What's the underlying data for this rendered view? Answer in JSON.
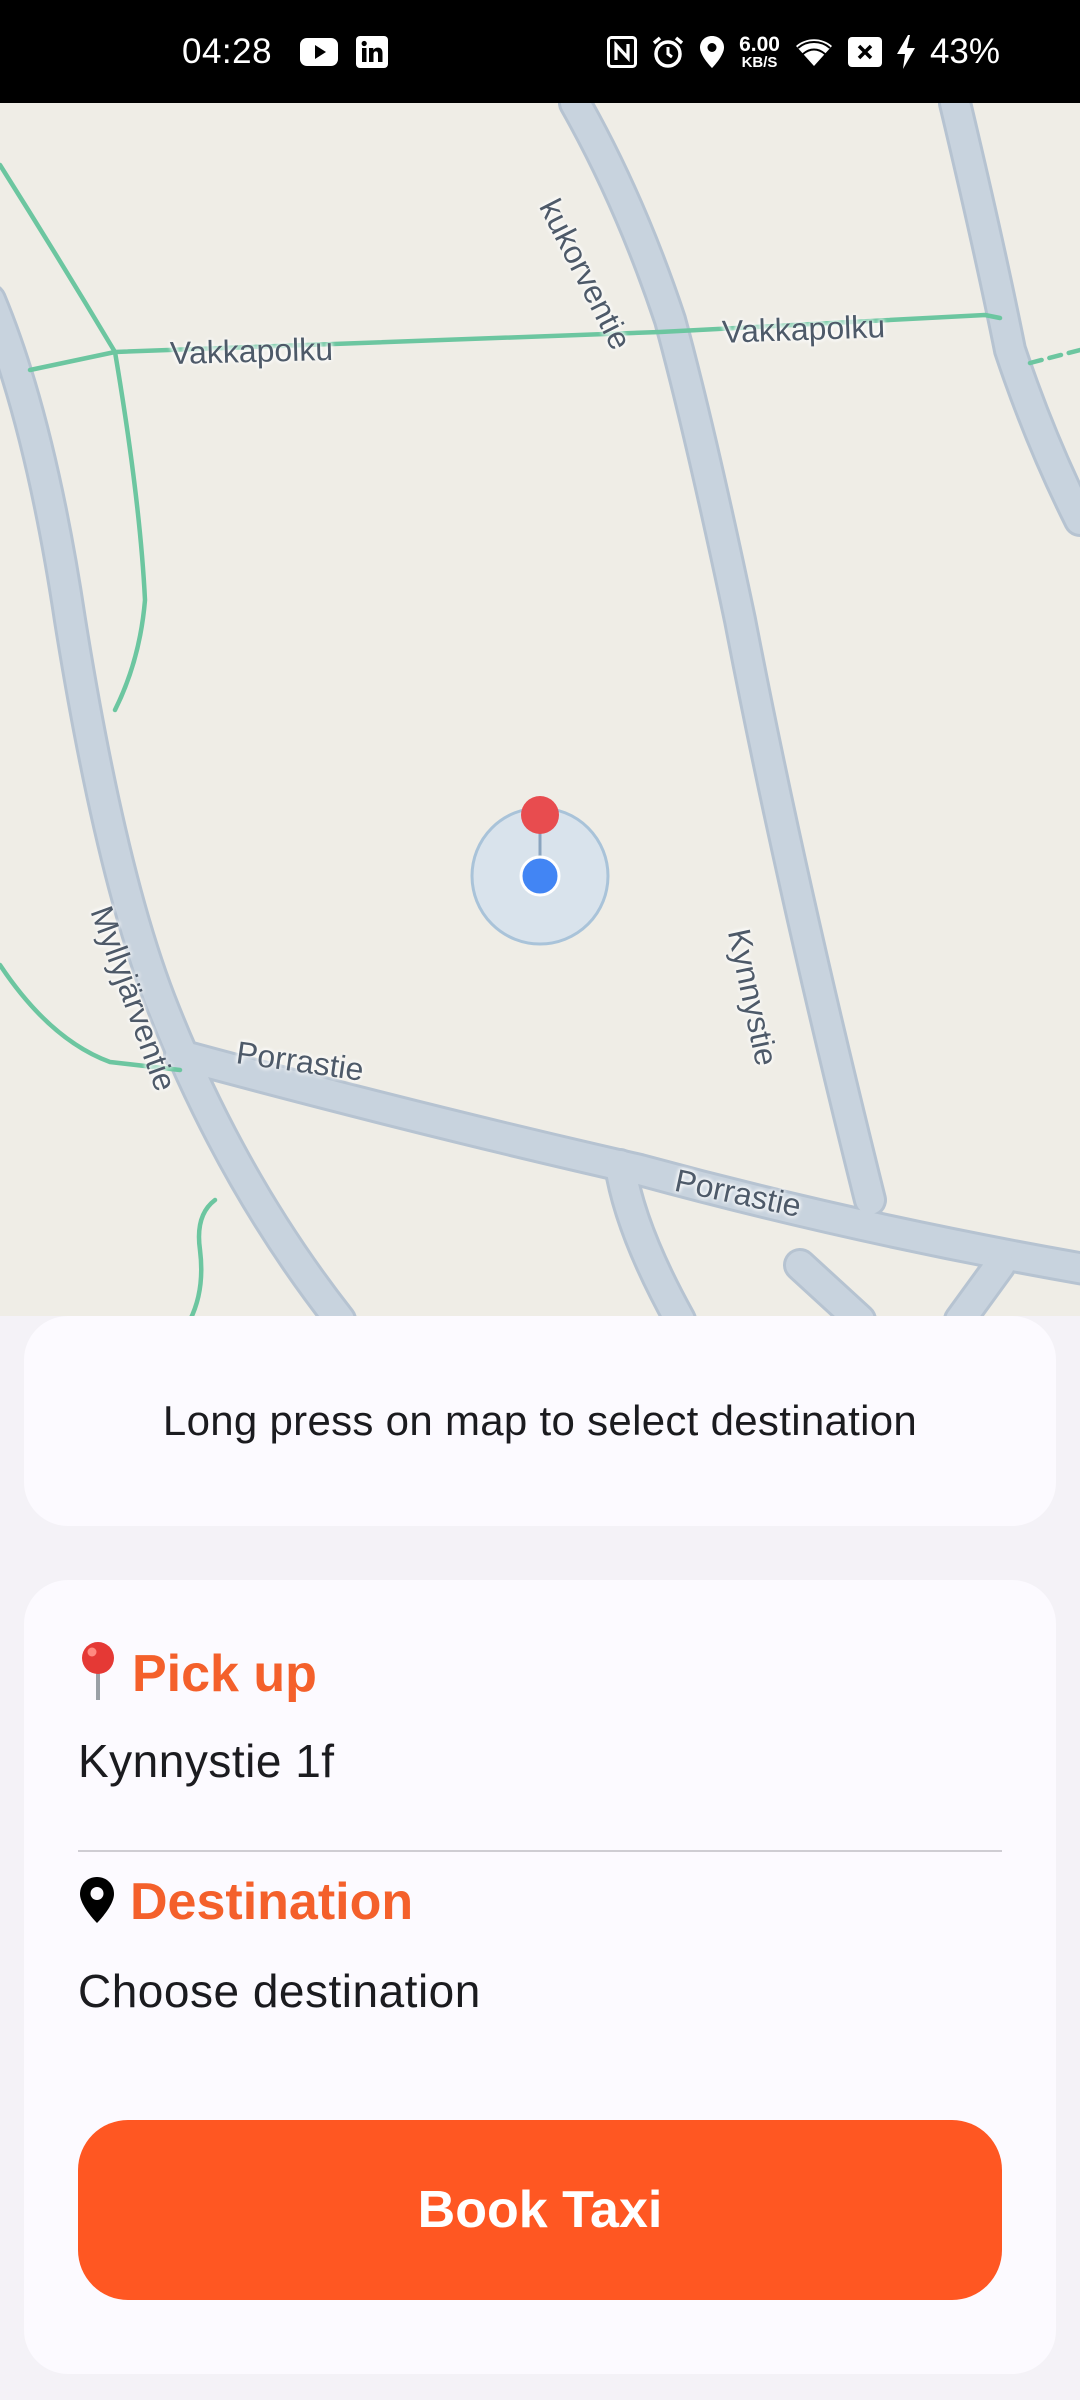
{
  "status_bar": {
    "time": "04:28",
    "net_speed_value": "6.00",
    "net_speed_unit": "KB/S",
    "battery": "43%",
    "left_icons": [
      "youtube-icon",
      "linkedin-icon"
    ],
    "right_icons": [
      "nfc-icon",
      "alarm-icon",
      "location-icon",
      "wifi-icon",
      "sim-off-icon",
      "charging-icon"
    ]
  },
  "map": {
    "streets": [
      "Vakkapolku",
      "Vakkapolku",
      "kukorventie",
      "Kynnystie",
      "Myllyjärventie",
      "Porrastie",
      "Porrastie"
    ],
    "colors": {
      "road": "#c8d3de",
      "path": "#6cc6a0",
      "land": "#efede6",
      "user_dot": "#4285f4",
      "pin": "#e84c4f"
    }
  },
  "hint": {
    "text": "Long press on map to select destination"
  },
  "pickup": {
    "icon": "red-pin-icon",
    "label": "Pick up",
    "value": "Kynnystie 1f"
  },
  "destination": {
    "icon": "location-marker-icon",
    "label": "Destination",
    "value": "Choose destination"
  },
  "book_button": {
    "label": "Book Taxi",
    "color": "#ff5722"
  },
  "accent_color": "#f4602b"
}
